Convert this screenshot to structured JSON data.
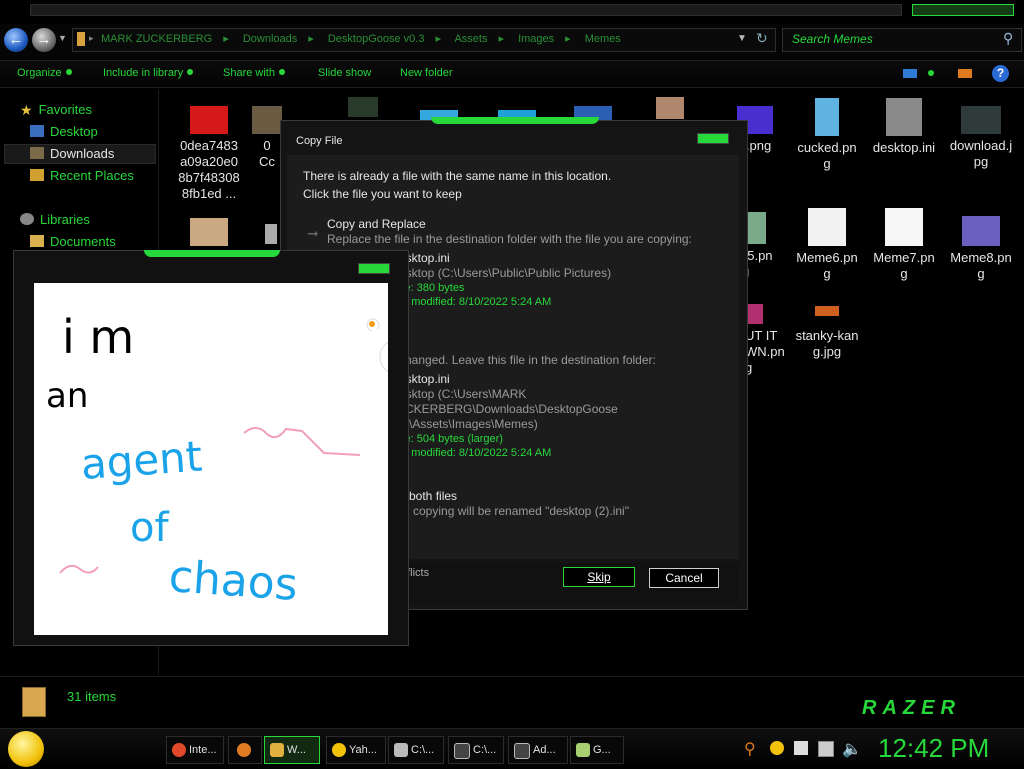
{
  "window": {
    "breadcrumbs": [
      "MARK ZUCKERBERG",
      "Downloads",
      "DesktopGoose v0.3",
      "Assets",
      "Images",
      "Memes"
    ],
    "search_placeholder": "Search Memes"
  },
  "toolbar": {
    "organize": "Organize",
    "include_in_library": "Include in library",
    "share_with": "Share with",
    "slide_show": "Slide show",
    "new_folder": "New folder"
  },
  "nav": {
    "favorites": "Favorites",
    "desktop": "Desktop",
    "downloads": "Downloads",
    "recent_places": "Recent Places",
    "libraries": "Libraries",
    "documents": "Documents"
  },
  "files": {
    "f1": "0dea7483a09a20e08b7f483088fb1ed ...",
    "f2_partial": "0",
    "f2_partial2": "Cc",
    "f_png0": "0.png",
    "cucked": "cucked.png",
    "desktop_ini": "desktop.ini",
    "download_jpg": "download.jpg",
    "meme5_partial": "e5.pn",
    "meme5_partial2": "g",
    "meme6": "Meme6.png",
    "meme7": "Meme7.png",
    "meme8": "Meme8.png",
    "ut_it_1": "UT IT",
    "ut_it_2": "WN.pn",
    "ut_it_3": "g",
    "stanky": "stanky-kang.jpg"
  },
  "copy_dialog": {
    "title": "Copy File",
    "message_line1": "There is already a file with the same name in this location.",
    "message_line2": "Click the file you want to keep",
    "option1_title": "Copy and Replace",
    "option1_desc": "Replace the file in the destination folder with the file you are copying:",
    "option1_filename": "esktop.ini",
    "option1_location": "esktop (C:\\Users\\Public\\Public Pictures)",
    "option1_size": "ze: 380 bytes",
    "option1_modified": "te modified: 8/10/2022 5:24 AM",
    "option2_desc": "changed. Leave this file in the destination folder:",
    "option2_filename": "esktop.ini",
    "option2_location1": "esktop (C:\\Users\\MARK",
    "option2_location2": "JCKERBERG\\Downloads\\DesktopGoose",
    "option2_location3": ".3\\Assets\\Images\\Memes)",
    "option2_size": "ze: 504 bytes (larger)",
    "option2_modified": "te modified: 8/10/2022 5:24 AM",
    "option3_title": "both files",
    "option3_desc": "copying will be renamed \"desktop (2).ini\"",
    "footer_text": "nflicts",
    "skip": "Skip",
    "cancel": "Cancel"
  },
  "drawing": {
    "line1": "i m",
    "line2": "an",
    "line3": "agent",
    "line4": "of",
    "line5": "chaos"
  },
  "status": {
    "item_count": "31 items",
    "brand": "RAZER"
  },
  "taskbar": {
    "items": [
      "Inte...",
      "",
      "W...",
      "Yah...",
      "C:\\...",
      "C:\\...",
      "Ad...",
      "G..."
    ],
    "clock": "12:42 PM"
  },
  "colors": {
    "accent": "#27d83a",
    "background": "#000000",
    "drawing_black": "#000000",
    "drawing_blue": "#1aa3e8",
    "drawing_pink": "#f2a0b8"
  }
}
